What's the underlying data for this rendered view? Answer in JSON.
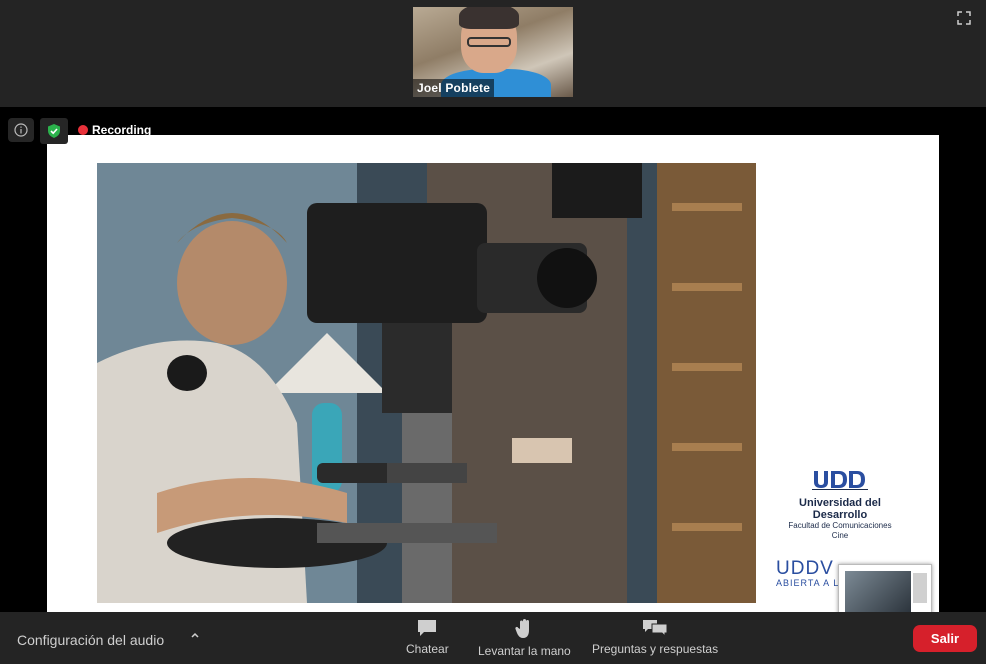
{
  "participant": {
    "name": "Joel Poblete"
  },
  "status": {
    "recording_label": "Recording"
  },
  "slide": {
    "institution": "Universidad del Desarrollo",
    "faculty": "Facultad de Comunicaciones",
    "department": "Cine",
    "brand": "UDDV",
    "brand_tagline": "ABIERTA A LA"
  },
  "toolbar": {
    "audio_label": "Configuración del audio",
    "chat_label": "Chatear",
    "raise_hand_label": "Levantar la mano",
    "qa_label": "Preguntas y respuestas",
    "leave_label": "Salir"
  },
  "colors": {
    "leave_button": "#d6202b",
    "recording_dot": "#e8313a",
    "shield": "#2bb24c",
    "udd_blue": "#2a4ea0"
  },
  "icons": {
    "info": "info-icon",
    "shield": "shield-check-icon",
    "fullscreen": "fullscreen-icon",
    "chat": "chat-icon",
    "hand": "hand-icon",
    "qa": "qa-icon",
    "chevron": "chevron-up-icon"
  }
}
